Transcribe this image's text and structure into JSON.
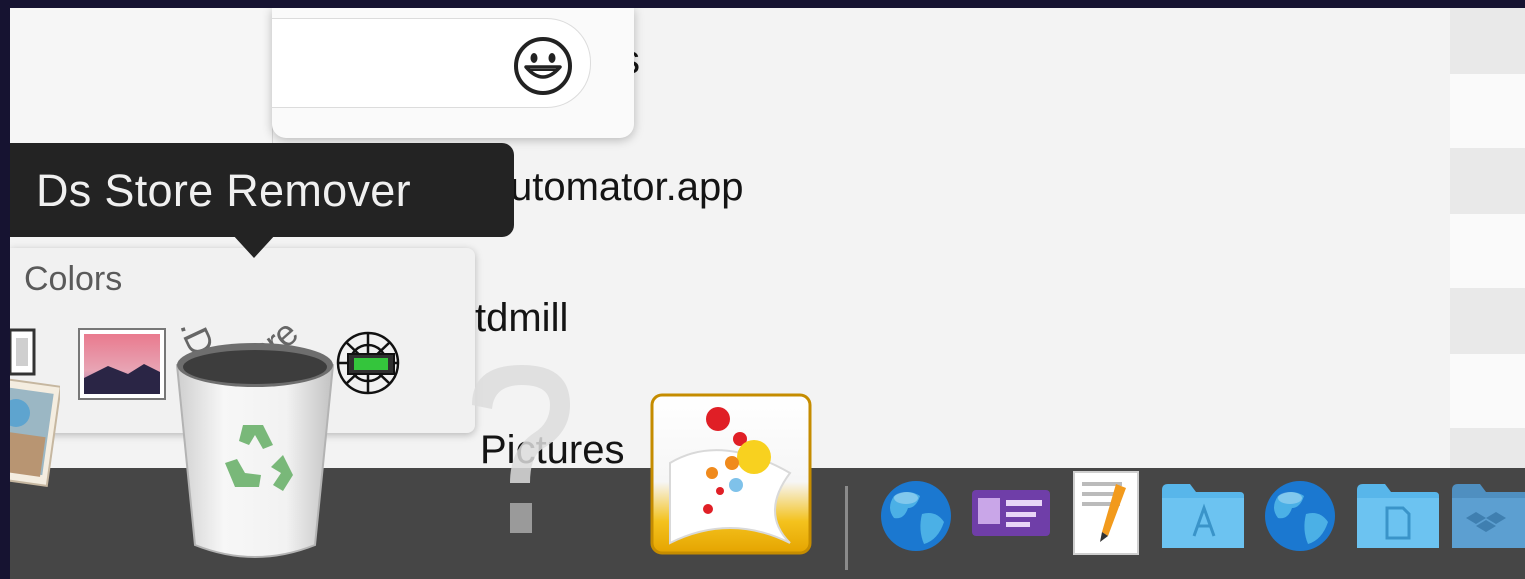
{
  "tooltip": {
    "text": "Ds Store Remover"
  },
  "colors_panel": {
    "label": "Colors"
  },
  "file_list": {
    "rows": [
      {
        "text": "s"
      },
      {
        "text": "utomator.app"
      },
      {
        "text": "tdmill"
      },
      {
        "text": "Pictures"
      }
    ]
  },
  "dragged_item": {
    "label": ".Ds_Store"
  },
  "dock": {
    "items": [
      {
        "name": "photos-app",
        "icon": "photo-stack-icon"
      },
      {
        "name": "trash",
        "icon": "trash-recycle-icon"
      },
      {
        "name": "unknown-app",
        "icon": "question-mark-icon"
      },
      {
        "name": "ds-store-remover",
        "icon": "paint-splash-app-icon"
      },
      {
        "name": "web-location-1",
        "icon": "globe-icon"
      },
      {
        "name": "contact-card",
        "icon": "vcard-icon"
      },
      {
        "name": "textedit-doc",
        "icon": "document-pen-icon"
      },
      {
        "name": "applications-folder",
        "icon": "applications-folder-icon"
      },
      {
        "name": "web-location-2",
        "icon": "globe-icon"
      },
      {
        "name": "documents-folder",
        "icon": "document-folder-icon"
      },
      {
        "name": "dropbox-folder",
        "icon": "dropbox-folder-icon"
      }
    ]
  },
  "colors": {
    "background": "#161331",
    "tooltip_bg": "#232323",
    "dock_bg": "#464646",
    "folder_blue": "#62bff0"
  }
}
